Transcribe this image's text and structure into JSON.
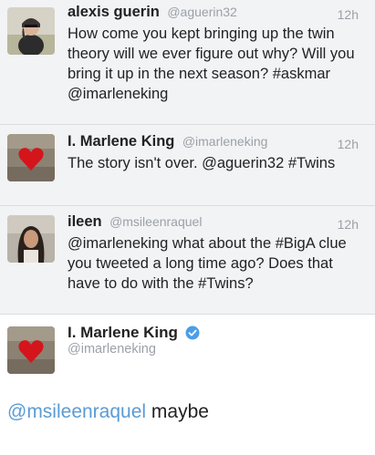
{
  "colors": {
    "background_thread": "#f2f3f5",
    "link_blue": "#5a9bd5",
    "verified_blue": "#4a9ee8",
    "muted_text": "#9aa1a8"
  },
  "tweets": [
    {
      "name": "alexis guerin",
      "handle": "@aguerin32",
      "time": "12h",
      "text_lines": [
        "How come you kept bringing up the twin",
        "theory will we ever figure out why? Will you",
        "bring it up in the next season? #askmar",
        "@imarleneking"
      ]
    },
    {
      "name": "I. Marlene King",
      "handle": "@imarleneking",
      "time": "12h",
      "text_lines": [
        "The story isn't over. @aguerin32 #Twins"
      ]
    },
    {
      "name": "ileen",
      "handle": "@msileenraquel",
      "time": "12h",
      "text_lines": [
        "@imarleneking what about the #BigA clue",
        "you tweeted a long time ago? Does that",
        "have to do with the #Twins?"
      ]
    }
  ],
  "detail": {
    "name": "I. Marlene King",
    "verified_icon": "verified-badge-icon",
    "handle": "@imarleneking",
    "mention": "@msileenraquel",
    "text": "maybe"
  }
}
